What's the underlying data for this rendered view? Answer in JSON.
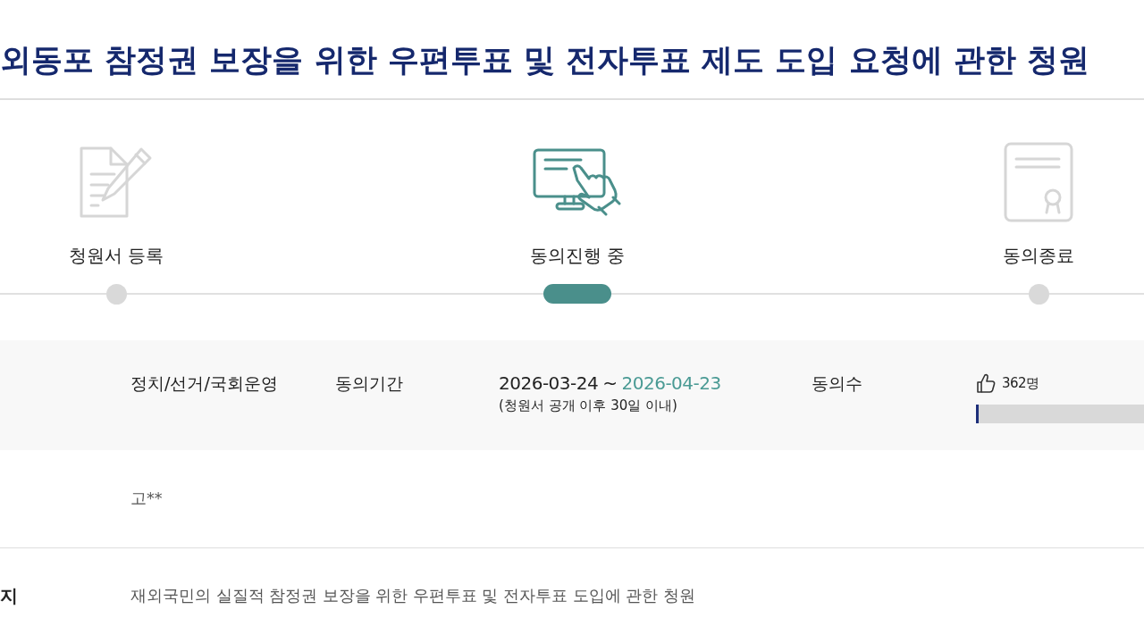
{
  "title": "외동포 참정권 보장을 위한 우편투표 및 전자투표 제도 도입 요청에 관한 청원",
  "steps": [
    {
      "kind": "register",
      "label": "청원서 등록",
      "selected": false
    },
    {
      "kind": "progress",
      "label": "동의진행 중",
      "selected": true
    },
    {
      "kind": "complete",
      "label": "동의종료",
      "selected": false
    }
  ],
  "info": {
    "category": "정치/선거/국회운영",
    "period": {
      "label": "동의기간",
      "start": "2026-03-24",
      "separator": "~",
      "end": "2026-04-23",
      "note": "(청원서 공개 이후 30일 이내)"
    },
    "consent": {
      "label": "동의수",
      "count": "362명",
      "level": 0.016
    }
  },
  "author": "고**",
  "summary": {
    "label": "지",
    "text": "재외국민의 실질적 참정권 보장을 위한 우편투표 및 전자투표 도입에 관한 청원"
  }
}
